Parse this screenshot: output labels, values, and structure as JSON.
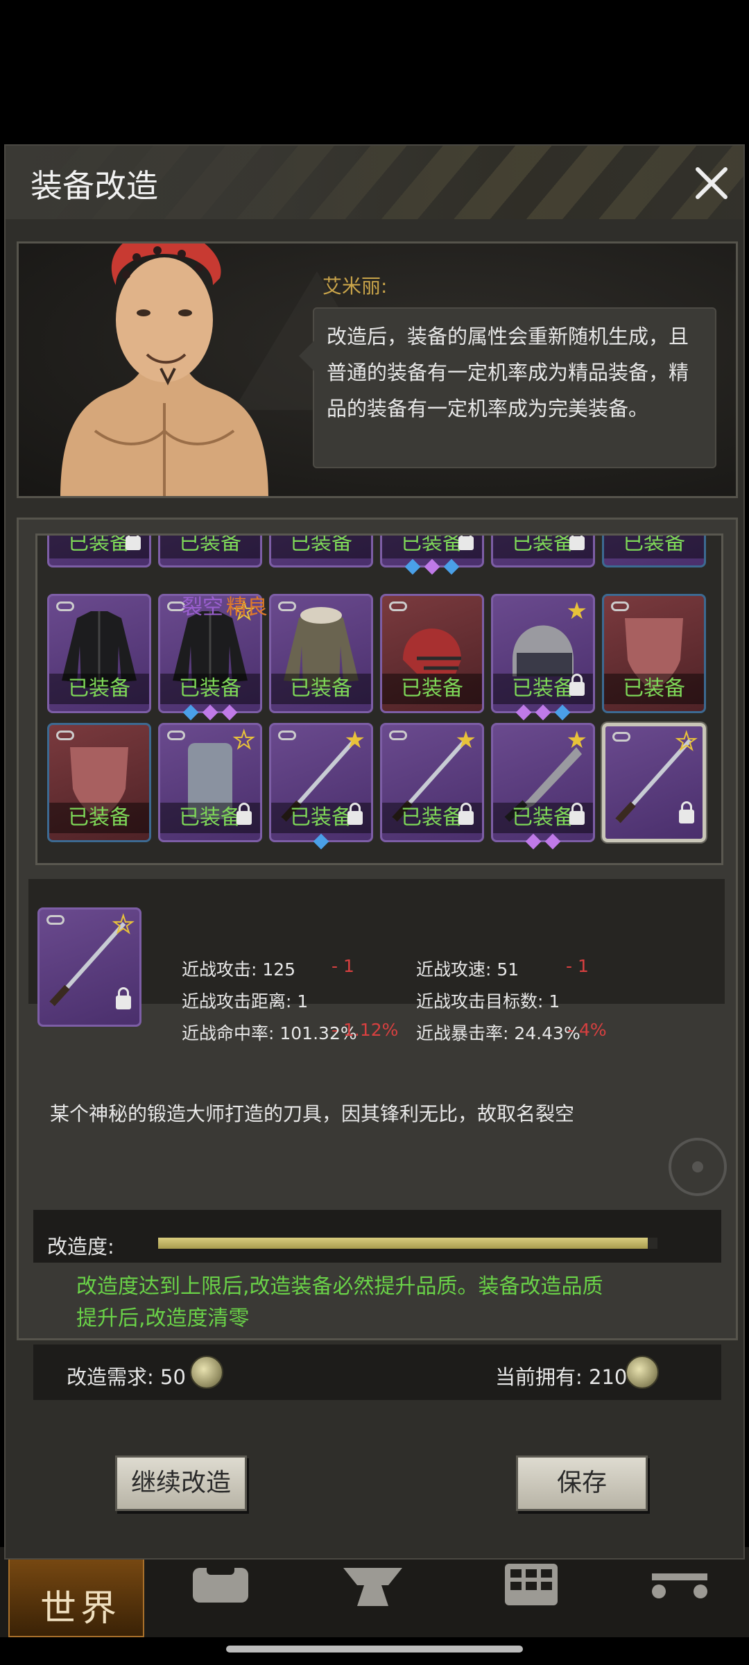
{
  "dialog": {
    "title": "装备改造"
  },
  "npc": {
    "name": "艾米丽:",
    "speech": "改造后，装备的属性会重新随机生成，且普通的装备有一定机率成为精品装备，精品的装备有一定机率成为完美装备。"
  },
  "equipment": {
    "equipped_label": "已装备",
    "rows": [
      [
        "已装备",
        "已装备",
        "已装备",
        "已装备",
        "已装备",
        "已装备"
      ],
      [
        "已装备",
        "已装备",
        "已装备",
        "已装备",
        "已装备",
        "已装备"
      ],
      [
        "已装备",
        "已装备",
        "已装备",
        "已装备",
        "已装备"
      ]
    ]
  },
  "selected_item": {
    "name": "裂空",
    "grade": "精良",
    "stats": {
      "melee_attack": "近战攻击: 125",
      "melee_attack_delta": "- 1",
      "melee_speed": "近战攻速: 51",
      "melee_speed_delta": "- 1",
      "melee_range": "近战攻击距离: 1",
      "melee_targets": "近战攻击目标数: 1",
      "melee_hit": "近战命中率: 101.32%",
      "melee_hit_delta": "- 1.12%",
      "melee_crit": "近战暴击率: 24.43%",
      "melee_crit_delta": "- 4%"
    },
    "description": "某个神秘的锻造大师打造的刀具，因其锋利无比，故取名裂空"
  },
  "modify": {
    "progress_label": "改造度:",
    "progress_fraction": 0.98,
    "note": "改造度达到上限后,改造装备必然提升品质。装备改造品质提升后,改造度清零",
    "requirement": "改造需求: 50",
    "owned": "当前拥有: 210"
  },
  "buttons": {
    "continue": "继续改造",
    "save": "保存"
  },
  "bottom_nav": {
    "world": "世界"
  },
  "colors": {
    "equipped_text": "#7ed858",
    "note_text": "#6ad248",
    "item_name": "#9b5fd0",
    "item_grade": "#e07a2a",
    "delta": "#d84040",
    "npc_name": "#c9a44a"
  }
}
